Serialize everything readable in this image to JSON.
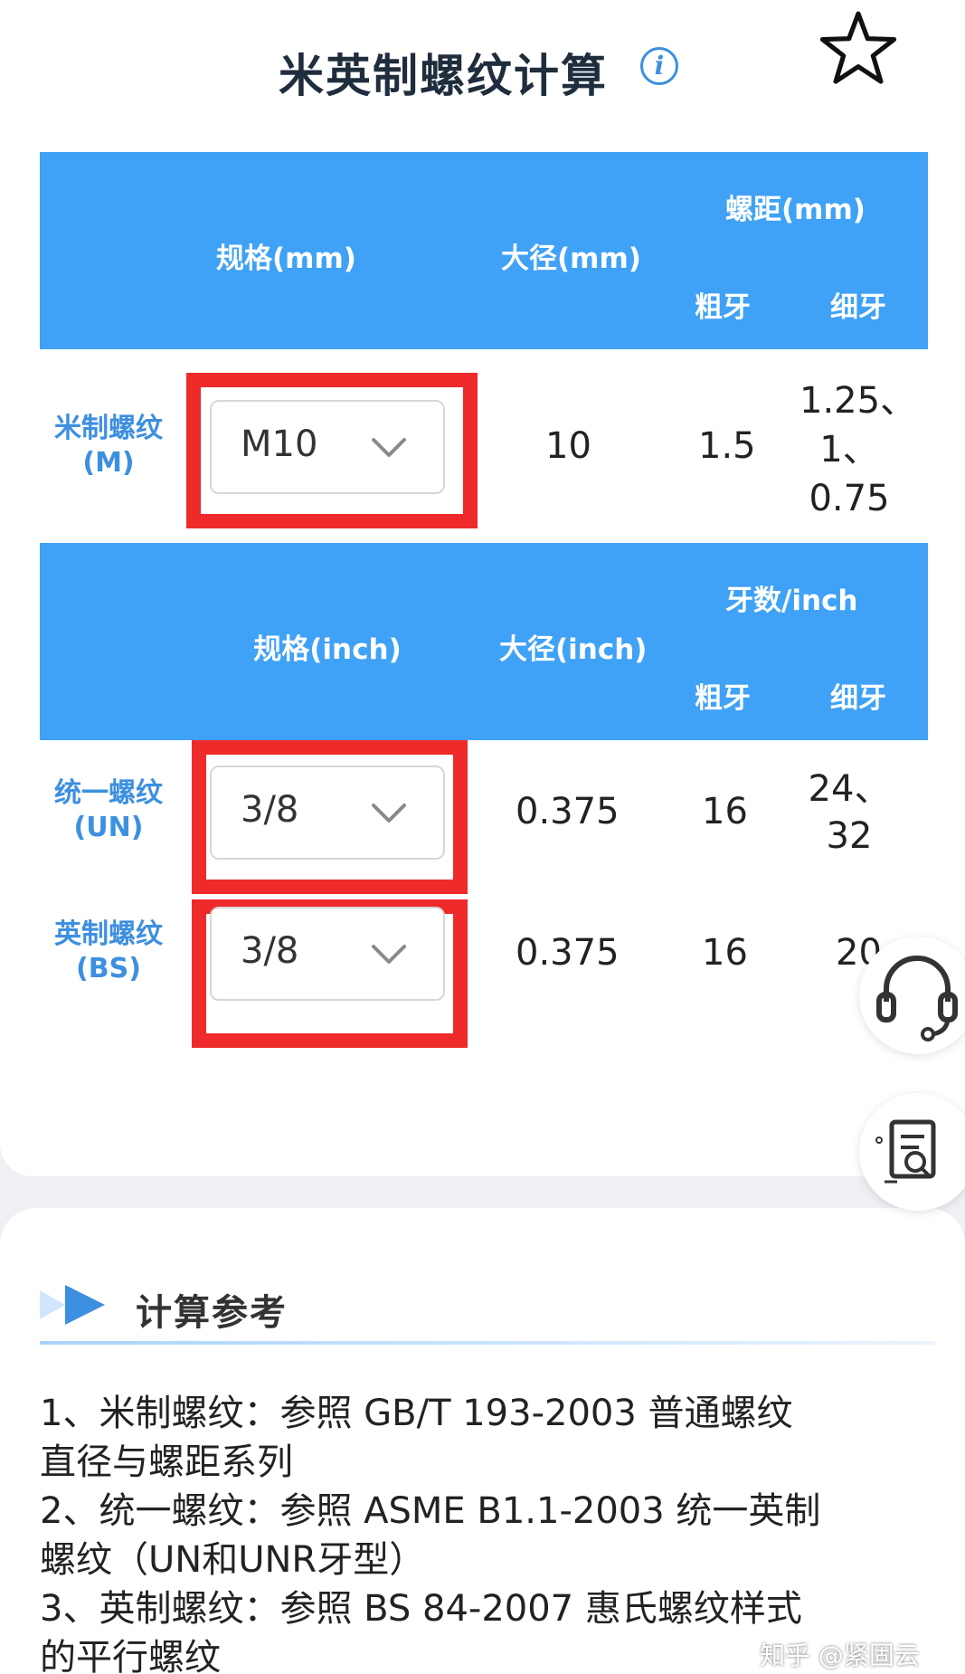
{
  "header": {
    "title": "米英制螺纹计算",
    "info_icon_glyph": "i"
  },
  "metric": {
    "headers": {
      "spec": "规格(mm)",
      "major_diameter": "大径(mm)",
      "pitch_group": "螺距(mm)",
      "coarse": "粗牙",
      "fine": "细牙"
    },
    "rows": [
      {
        "label_line1": "米制螺纹",
        "label_line2": "(M)",
        "spec": "M10",
        "major_diameter": "10",
        "coarse": "1.5",
        "fine_line1": "1.25、",
        "fine_line2": "1、",
        "fine_line3": "0.75"
      }
    ]
  },
  "inch": {
    "headers": {
      "spec": "规格(inch)",
      "major_diameter": "大径(inch)",
      "tpi_group": "牙数/inch",
      "coarse": "粗牙",
      "fine": "细牙"
    },
    "rows": [
      {
        "label_line1": "统一螺纹",
        "label_line2": "(UN)",
        "spec": "3/8",
        "major_diameter": "0.375",
        "coarse": "16",
        "fine_line1": "24、",
        "fine_line2": "32"
      },
      {
        "label_line1": "英制螺纹",
        "label_line2": "(BS)",
        "spec": "3/8",
        "major_diameter": "0.375",
        "coarse": "16",
        "fine_line1": "20"
      }
    ]
  },
  "reference": {
    "title": "计算参考",
    "lines": [
      "1、米制螺纹：参照 GB/T 193-2003 普通螺纹",
      "直径与螺距系列",
      "2、统一螺纹：参照 ASME B1.1-2003 统一英制",
      "螺纹（UN和UNR牙型）",
      "3、英制螺纹：参照 BS 84-2007 惠氏螺纹样式",
      "的平行螺纹"
    ]
  },
  "watermark": "知乎 @紧固云",
  "colors": {
    "header_band": "#3fa2f6",
    "label_blue": "#3d8fe0",
    "highlight_red": "#ee2a2a"
  },
  "icons": [
    "info-icon",
    "star-icon",
    "chevron-down-icon",
    "headset-icon",
    "document-search-icon",
    "play-arrow-icon"
  ]
}
